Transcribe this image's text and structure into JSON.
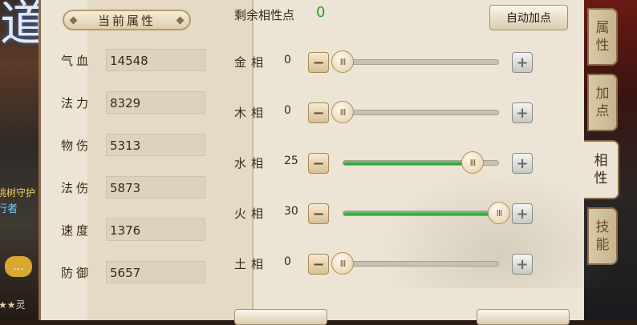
{
  "background": {
    "corner_glyph": "道",
    "npc_name_partial": "桃树守护",
    "npc_title_partial": "行者",
    "chat_icon": "chat-bubble-icon",
    "bottom_text_partial": "★★灵"
  },
  "left_panel": {
    "title": "当前属性",
    "stats": [
      {
        "label": "气血",
        "value": "14548"
      },
      {
        "label": "法力",
        "value": "8329"
      },
      {
        "label": "物伤",
        "value": "5313"
      },
      {
        "label": "法伤",
        "value": "5873"
      },
      {
        "label": "速度",
        "value": "1376"
      },
      {
        "label": "防御",
        "value": "5657"
      }
    ]
  },
  "right_panel": {
    "remaining_label": "剩余相性点",
    "remaining_value": "0",
    "auto_button": "自动加点",
    "affinities": [
      {
        "label": "金相",
        "value": 0,
        "fill_percent": 0
      },
      {
        "label": "木相",
        "value": 0,
        "fill_percent": 0
      },
      {
        "label": "水相",
        "value": 25,
        "fill_percent": 83
      },
      {
        "label": "火相",
        "value": 30,
        "fill_percent": 100
      },
      {
        "label": "土相",
        "value": 0,
        "fill_percent": 0
      }
    ],
    "minus_glyph": "−",
    "plus_glyph": "+",
    "thumb_glyph": "III"
  },
  "tabs": [
    {
      "label": "属性",
      "active": false
    },
    {
      "label": "加点",
      "active": false
    },
    {
      "label": "相性",
      "active": true
    },
    {
      "label": "技能",
      "active": false
    }
  ],
  "colors": {
    "accent_green": "#2ea02a",
    "panel_bg": "#ece4d4",
    "border_brown": "#8a6a48"
  }
}
